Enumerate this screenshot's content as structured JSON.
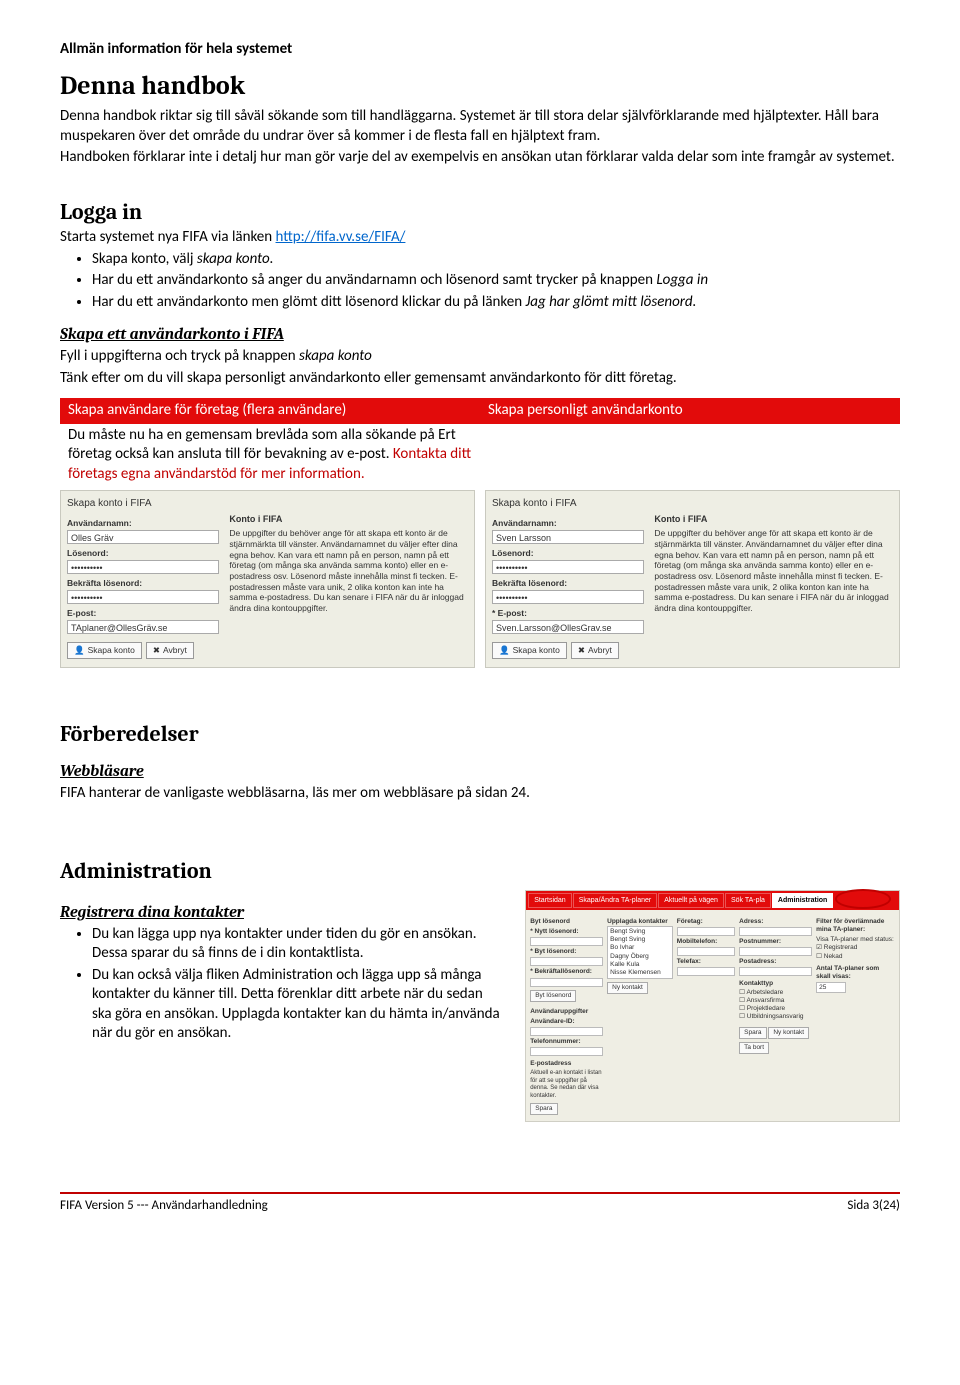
{
  "header": {
    "section_title": "Allmän information för hela systemet"
  },
  "intro": {
    "heading": "Denna handbok",
    "p1": "Denna handbok riktar sig till såväl sökande som till handläggarna. Systemet är till stora delar självförklarande med hjälptexter. Håll bara muspekaren över det område du undrar över så kommer i de flesta fall en hjälptext fram.",
    "p2": "Handboken förklarar inte i detalj hur man gör varje del av exempelvis en ansökan utan förklarar valda delar som inte framgår av systemet."
  },
  "login": {
    "heading": "Logga in",
    "lead_prefix": "Starta systemet nya FIFA via länken ",
    "link": "http://fifa.vv.se/FIFA/",
    "bullets": [
      {
        "pre": "Skapa konto, välj ",
        "it": "skapa konto.",
        "post": ""
      },
      {
        "pre": "Har du ett användarkonto så anger du användarnamn och lösenord samt trycker på knappen ",
        "it": "Logga in",
        "post": ""
      },
      {
        "pre": "Har du ett användarkonto men glömt ditt lösenord klickar du på länken ",
        "it": "Jag har glömt mitt lösenord.",
        "post": ""
      }
    ],
    "create_heading": "Skapa ett användarkonto i FIFA",
    "create_p1_pre": "Fyll i uppgifterna och tryck på knappen ",
    "create_p1_it": "skapa konto",
    "create_p2": "Tänk efter om du vill skapa personligt användarkonto eller gemensamt användarkonto för ditt företag."
  },
  "table": {
    "col1_header": "Skapa användare för företag (flera användare)",
    "col2_header": "Skapa personligt användarkonto",
    "col1_text_pre": "Du måste nu ha en gemensam brevlåda som alla sökande på Ert företag också kan ansluta till för bevakning av e-post. ",
    "col1_text_red": "Kontakta ditt företags egna användarstöd för mer information."
  },
  "forms": {
    "panel_title": "Skapa konto i FIFA",
    "labels": {
      "user": "Användarnamn:",
      "pass": "Lösenord:",
      "confirm": "Bekräfta lösenord:",
      "email": "E-post:",
      "email_req": "* E-post:"
    },
    "left": {
      "user": "Olles Gräv",
      "pass": "••••••••••",
      "confirm": "••••••••••",
      "email": "TAplaner@OllesGräv.se"
    },
    "right": {
      "user": "Sven Larsson",
      "pass": "••••••••••",
      "confirm": "••••••••••",
      "email": "Sven.Larsson@OllesGrav.se"
    },
    "info_title": "Konto i FIFA",
    "info_text": "De uppgifter du behöver ange för att skapa ett konto är de stjärnmärkta till vänster. Användarnamnet du väljer efter dina egna behov. Kan vara ett namn på en person, namn på ett företag (om många ska använda samma konto) eller en e-postadress osv. Lösenord måste innehålla minst fi tecken. E-postadressen måste vara unik, 2 olika konton kan inte ha samma e-postadress. Du kan senare i FIFA när du är inloggad ändra dina kontouppgifter.",
    "btn_create": "Skapa konto",
    "btn_cancel": "Avbryt"
  },
  "prep": {
    "heading": "Förberedelser",
    "sub": "Webbläsare",
    "text": "FIFA hanterar de vanligaste webbläsarna, läs mer om webbläsare på sidan 24."
  },
  "admin": {
    "heading": "Administration",
    "sub": "Registrera dina kontakter",
    "bullets": [
      "Du kan lägga upp nya kontakter under tiden du gör en ansökan. Dessa sparar du så finns de i din kontaktlista.",
      "Du kan också välja fliken Administration och lägga upp så många kontakter du känner till.  Detta förenklar ditt arbete när du sedan ska göra en ansökan. Upplagda kontakter kan du hämta in/använda när du gör en ansökan."
    ],
    "tabs": [
      "Startsidan",
      "Skapa/Ändra TA-planer",
      "Aktuellt på vägen",
      "Sök TA-pla",
      "Administration"
    ],
    "col1": {
      "t1": "Byt lösenord",
      "f1": "* Nytt lösenord:",
      "f2": "* Byt lösenord:",
      "f3": "* Bekräftallösenord:",
      "btn": "Byt lösenord",
      "t2": "Användaruppgifter",
      "f4": "Användare-ID:",
      "f5": "Telefonnummer:",
      "t3": "E-postadress",
      "hint": "Aktuell e-an kontakt i listan för att se uppgifter på denna. Se nedan där visa kontakter.",
      "btn2": "Spara"
    },
    "col2": {
      "t1": "Upplagda kontakter",
      "names": [
        "Bengt Sving",
        "Bengt Sving",
        "Bo Ivhar",
        "Dagny Öberg",
        "Kalle Kula",
        "Nisse Klemensen"
      ],
      "btn": "Ny kontakt"
    },
    "col3": {
      "f1": "Företag:",
      "f2": "Mobiltelefon:",
      "f3": "Telefax:"
    },
    "col4": {
      "f1": "Adress:",
      "f2": "Postnummer:",
      "f3": "Postadress:",
      "t1": "Kontakttyp",
      "chk": [
        "Arbetsledare",
        "Ansvarsfirma",
        "Projektledare",
        "Utbildningsansvarig"
      ],
      "btns": [
        "Spara",
        "Ny kontakt",
        "Ta bort"
      ]
    },
    "col5": {
      "t1": "Filter för överlämnade mina TA-planer:",
      "opt1": "Visa TA-planer med status:",
      "chk1": "Registrerad",
      "chk2": "Nekad",
      "t2": "Antal TA-planer som skall visas:",
      "v2": "25"
    }
  },
  "footer": {
    "left": "FIFA Version 5  ---  Användarhandledning",
    "right": "Sida 3(24)"
  }
}
